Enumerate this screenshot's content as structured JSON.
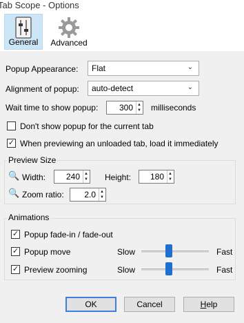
{
  "window": {
    "title": "Tab Scope - Options"
  },
  "toolbar": {
    "general_label": "General",
    "advanced_label": "Advanced"
  },
  "popup_appearance": {
    "label": "Popup Appearance:",
    "value": "Flat"
  },
  "alignment": {
    "label": "Alignment of popup:",
    "value": "auto-detect"
  },
  "wait_time": {
    "label": "Wait time to show popup:",
    "value": "300",
    "unit": "milliseconds"
  },
  "checkboxes": {
    "dont_show_current": {
      "label": "Don't show popup for the current tab",
      "checked": false
    },
    "load_unloaded": {
      "label": "When previewing an unloaded tab, load it immediately",
      "checked": true
    }
  },
  "preview_size": {
    "title": "Preview Size",
    "width_label": "Width:",
    "width_value": "240",
    "height_label": "Height:",
    "height_value": "180",
    "zoom_label": "Zoom ratio:",
    "zoom_value": "2.0"
  },
  "animations": {
    "title": "Animations",
    "fade": {
      "label": "Popup fade-in / fade-out",
      "checked": true
    },
    "move": {
      "label": "Popup move",
      "checked": true,
      "slow": "Slow",
      "fast": "Fast",
      "level": 0.4
    },
    "zoom": {
      "label": "Preview zooming",
      "checked": true,
      "slow": "Slow",
      "fast": "Fast",
      "level": 0.4
    }
  },
  "buttons": {
    "ok": "OK",
    "cancel": "Cancel",
    "help_underlined": "H",
    "help_rest": "elp"
  },
  "icons": {
    "dropdown": "chevron-down-icon",
    "search": "magnifier-icon"
  }
}
